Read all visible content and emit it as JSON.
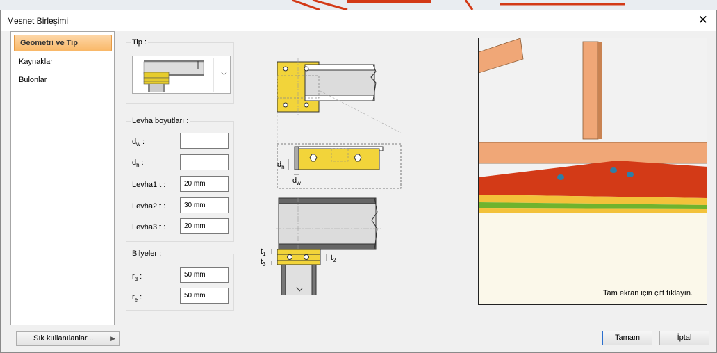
{
  "dialog": {
    "title": "Mesnet Birleşimi"
  },
  "nav": {
    "items": [
      "Geometri ve Tip",
      "Kaynaklar",
      "Bulonlar"
    ]
  },
  "tip": {
    "title": "Tip :"
  },
  "levha": {
    "title": "Levha boyutları :",
    "dw_label": "d",
    "dw_sub": "w",
    "dh_label": "d",
    "dh_sub": "h",
    "dw_value": "",
    "dh_value": "",
    "t1_label": "Levha1 t :",
    "t1_value": "20 mm",
    "t2_label": "Levha2 t :",
    "t2_value": "30 mm",
    "t3_label": "Levha3 t :",
    "t3_value": "20 mm"
  },
  "bilyeler": {
    "title": "Bilyeler :",
    "rd_label": "r",
    "rd_sub": "d",
    "rd_value": "50 mm",
    "re_label": "r",
    "re_sub": "e",
    "re_value": "50 mm"
  },
  "diagram": {
    "dh": "d",
    "dh_sub": "h",
    "dw": "d",
    "dw_sub": "w",
    "t1": "t",
    "t1_sub": "1",
    "t2": "t",
    "t2_sub": "2",
    "t3": "t",
    "t3_sub": "3"
  },
  "preview": {
    "hint": "Tam ekran için çift tıklayın."
  },
  "footer": {
    "favorites": "Sık kullanılanlar...",
    "ok": "Tamam",
    "cancel": "İptal"
  },
  "colors": {
    "accent": "#f9b868",
    "plate_yellow": "#f2d43a",
    "steel_red": "#d33a17"
  }
}
